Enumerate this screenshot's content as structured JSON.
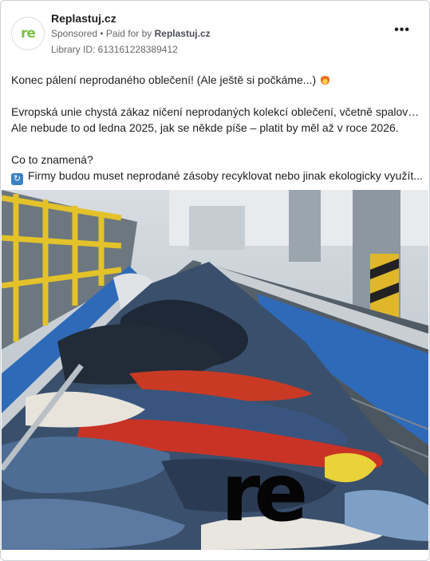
{
  "post": {
    "page_name": "Replastuj.cz",
    "avatar_text": "re",
    "sponsored": "Sponsored",
    "paid_prefix": " • Paid for by ",
    "paid_by": "Replastuj.cz",
    "library_id": "Library ID: 613161228389412",
    "more_label": "•••"
  },
  "body": {
    "line1": "Konec pálení neprodaného oblečení! (Ale ještě si počkáme...)",
    "line2": "Evropská unie chystá zákaz ničení neprodaných kolekcí oblečení, včetně spalování.",
    "line3": "Ale nebude to od ledna 2025, jak se někde píše – platit by měl až v roce 2026.",
    "line4": "Co to znamená?",
    "line5": "Firmy budou muset neprodané zásoby recyklovat nebo jinak ekologicky využít..."
  },
  "image": {
    "logo_text": "re"
  },
  "colors": {
    "brand_green": "#7ac143",
    "rail_yellow": "#e3c22a",
    "belt_blue": "#2f6ab8"
  }
}
